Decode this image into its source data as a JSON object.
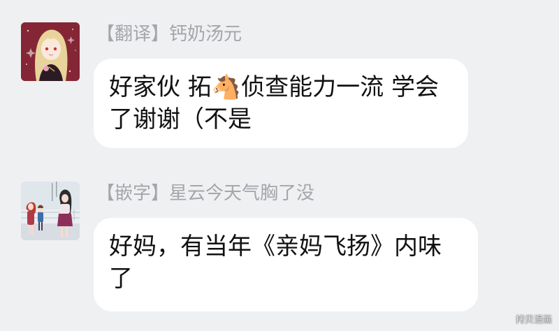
{
  "messages": [
    {
      "avatar": "avatar-anime-girl-blonde",
      "sender": "【翻译】钙奶汤元",
      "text": "好家伙 拓🐴侦查能力一流 学会了谢谢（不是"
    },
    {
      "avatar": "avatar-anime-characters-group",
      "sender": "【嵌字】星云今天气胸了没",
      "text": "好妈，有当年《亲妈飞扬》内味了"
    }
  ],
  "watermark": "拷贝漫画",
  "colors": {
    "background": "#eff0f2",
    "bubble": "#ffffff",
    "sender_name": "#a3a6ab",
    "message_text": "#111111"
  }
}
